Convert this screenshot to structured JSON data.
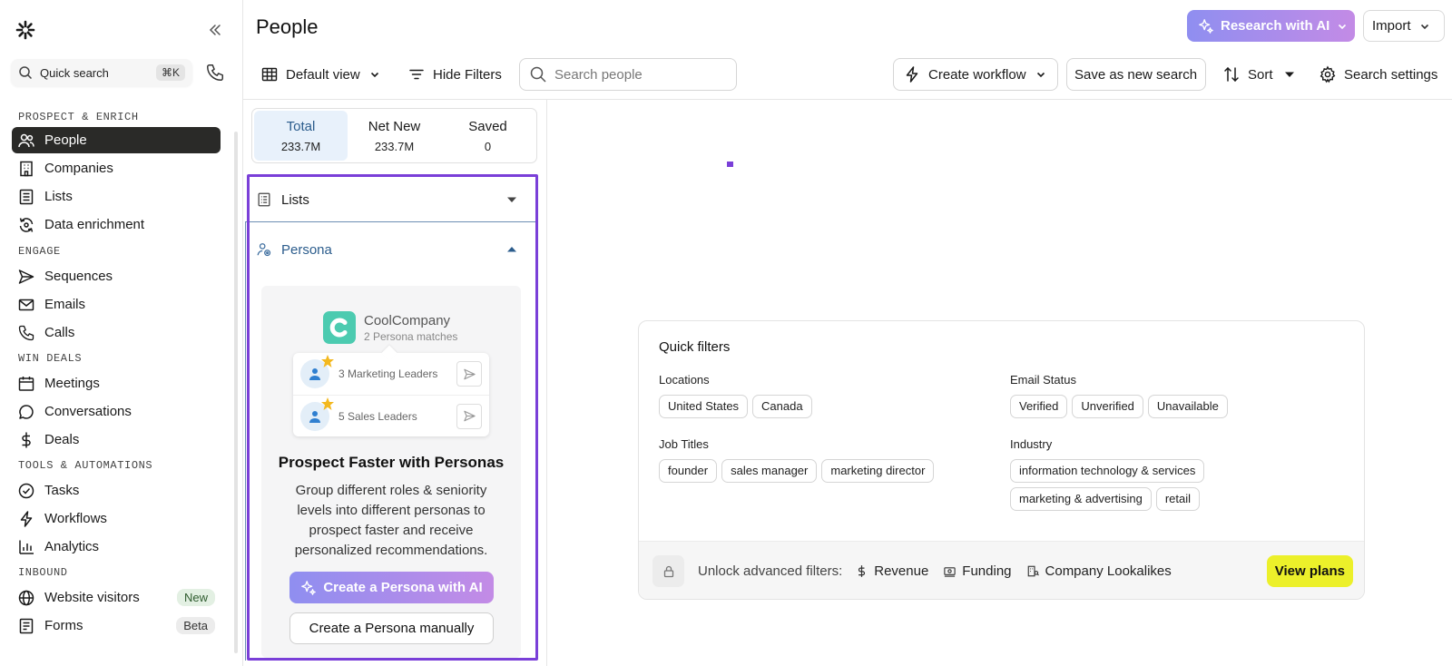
{
  "sidebar": {
    "quick_search": {
      "label": "Quick search",
      "shortcut": "⌘K"
    },
    "sections": {
      "prospect": "PROSPECT & ENRICH",
      "engage": "ENGAGE",
      "win": "WIN DEALS",
      "tools": "TOOLS & AUTOMATIONS",
      "inbound": "INBOUND"
    },
    "items": [
      {
        "label": "People",
        "icon": "people-icon",
        "active": true
      },
      {
        "label": "Companies",
        "icon": "building-icon"
      },
      {
        "label": "Lists",
        "icon": "list-icon"
      },
      {
        "label": "Data enrichment",
        "icon": "enrichment-icon"
      },
      {
        "label": "Sequences",
        "icon": "send-icon"
      },
      {
        "label": "Emails",
        "icon": "mail-icon"
      },
      {
        "label": "Calls",
        "icon": "phone-icon"
      },
      {
        "label": "Meetings",
        "icon": "calendar-icon"
      },
      {
        "label": "Conversations",
        "icon": "chat-icon"
      },
      {
        "label": "Deals",
        "icon": "dollar-icon"
      },
      {
        "label": "Tasks",
        "icon": "check-circle-icon"
      },
      {
        "label": "Workflows",
        "icon": "lightning-icon"
      },
      {
        "label": "Analytics",
        "icon": "bar-chart-icon"
      },
      {
        "label": "Website visitors",
        "icon": "globe-icon",
        "tag": "New"
      },
      {
        "label": "Forms",
        "icon": "form-icon",
        "tag": "Beta"
      }
    ]
  },
  "header": {
    "title": "People",
    "research_ai": "Research with AI",
    "import": "Import"
  },
  "toolbar": {
    "default_view": "Default view",
    "hide_filters": "Hide Filters",
    "search_placeholder": "Search people",
    "create_workflow": "Create workflow",
    "save_search": "Save as new search",
    "sort": "Sort",
    "search_settings": "Search settings"
  },
  "counts": [
    {
      "label": "Total",
      "value": "233.7M",
      "active": true
    },
    {
      "label": "Net New",
      "value": "233.7M"
    },
    {
      "label": "Saved",
      "value": "0"
    }
  ],
  "filters": {
    "lists_label": "Lists",
    "persona_label": "Persona"
  },
  "persona_promo": {
    "company_name": "CoolCompany",
    "company_sub": "2 Persona matches",
    "row1": "3 Marketing Leaders",
    "row2": "5 Sales Leaders",
    "title": "Prospect Faster with Personas",
    "body": "Group different roles & seniority levels into different personas to prospect faster and receive personalized recommendations.",
    "ai_button": "Create a Persona with AI",
    "manual_button": "Create a Persona manually"
  },
  "quick_filters": {
    "title": "Quick filters",
    "locations": {
      "label": "Locations",
      "chips": [
        "United States",
        "Canada"
      ]
    },
    "email_status": {
      "label": "Email Status",
      "chips": [
        "Verified",
        "Unverified",
        "Unavailable"
      ]
    },
    "job_titles": {
      "label": "Job Titles",
      "chips": [
        "founder",
        "sales manager",
        "marketing director"
      ]
    },
    "industry": {
      "label": "Industry",
      "chips": [
        "information technology & services",
        "marketing & advertising",
        "retail"
      ]
    },
    "unlock_label": "Unlock advanced filters:",
    "revenue": "Revenue",
    "funding": "Funding",
    "lookalikes": "Company Lookalikes",
    "view_plans": "View plans"
  },
  "colors": {
    "accent_purple": "#7a3fd8",
    "active_nav": "#2a2a28",
    "view_plans": "#ecf02a",
    "ai_gradient_start": "#8f8ef0",
    "ai_gradient_end": "#c38be6"
  }
}
